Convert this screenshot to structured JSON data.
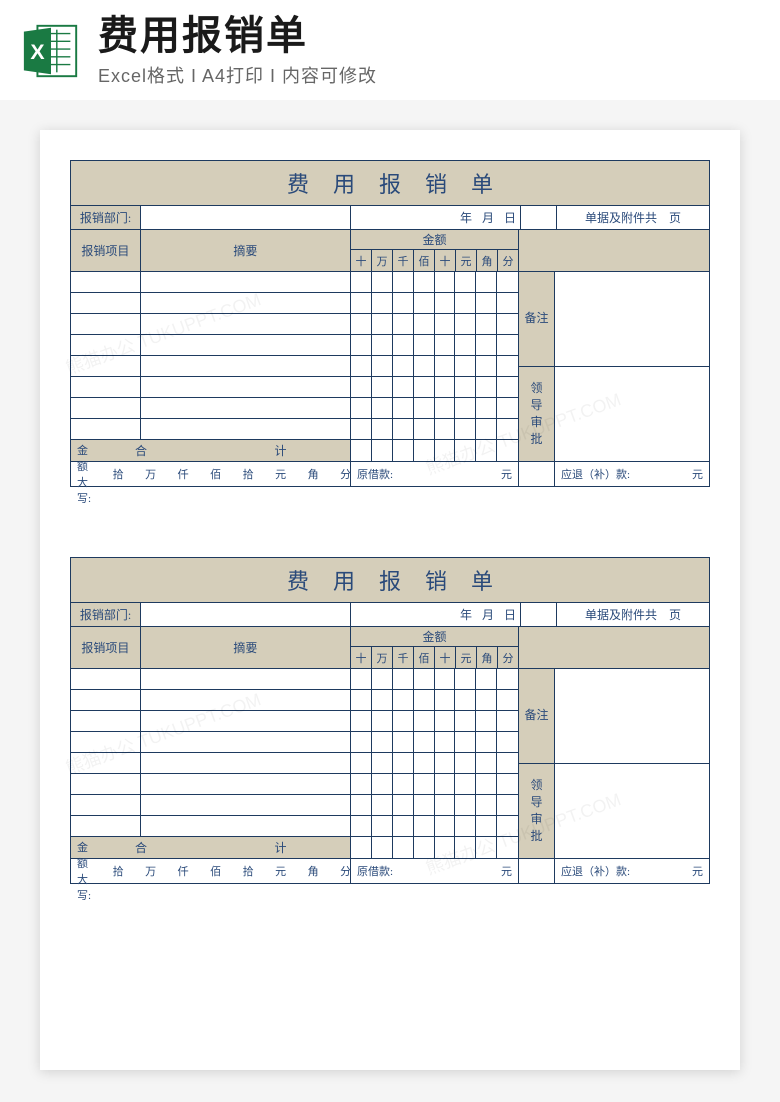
{
  "header": {
    "title": "费用报销单",
    "subtitle": "Excel格式 I A4打印 I 内容可修改",
    "icon_name": "excel-icon"
  },
  "form": {
    "title": "费用报销单",
    "dept_label": "报销部门:",
    "date_year": "年",
    "date_month": "月",
    "date_day": "日",
    "attach_label": "单据及附件共",
    "attach_unit": "页",
    "col_item": "报销项目",
    "col_summary": "摘要",
    "col_amount": "金额",
    "amount_units": [
      "十",
      "万",
      "千",
      "佰",
      "十",
      "元",
      "角",
      "分"
    ],
    "col_note": "备注",
    "col_leader": "领导审批",
    "sum_label_1": "合",
    "sum_label_2": "计",
    "footer_amount_cn": "金额大写:",
    "footer_cn_units": [
      "拾",
      "万",
      "仟",
      "佰",
      "拾",
      "元",
      "角",
      "分"
    ],
    "footer_loan": "原借款:",
    "footer_loan_unit": "元",
    "footer_refund": "应退（补）款:",
    "footer_refund_unit": "元",
    "body_rows": 8
  },
  "forms_count": 2
}
